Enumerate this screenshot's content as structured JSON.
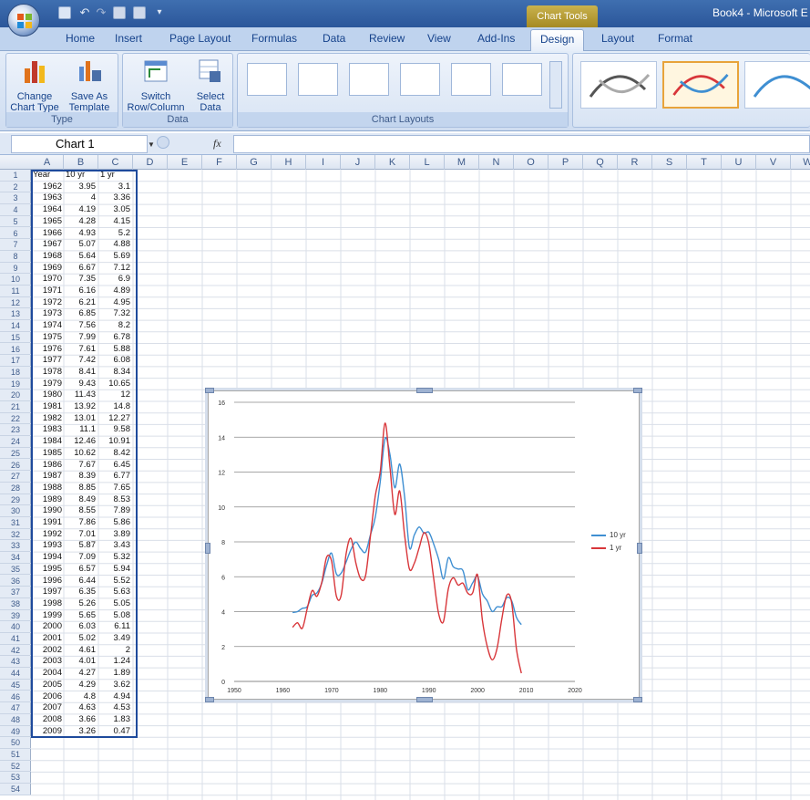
{
  "window": {
    "title": "Book4 - Microsoft E",
    "context_tab": "Chart Tools"
  },
  "tabs": [
    "Home",
    "Insert",
    "Page Layout",
    "Formulas",
    "Data",
    "Review",
    "View",
    "Add-Ins",
    "Design",
    "Layout",
    "Format"
  ],
  "active_tab": "Design",
  "ribbon": {
    "type_group": {
      "label": "Type",
      "buttons": [
        {
          "line1": "Change",
          "line2": "Chart Type"
        },
        {
          "line1": "Save As",
          "line2": "Template"
        }
      ]
    },
    "data_group": {
      "label": "Data",
      "buttons": [
        {
          "line1": "Switch",
          "line2": "Row/Column"
        },
        {
          "line1": "Select",
          "line2": "Data"
        }
      ]
    },
    "layouts_group": {
      "label": "Chart Layouts"
    },
    "colors": {
      "series_10yr": "#3f8fd2",
      "series_1yr": "#d8363a",
      "accent": "#e8a33a"
    }
  },
  "formula_bar": {
    "name_box": "Chart 1",
    "fx": "fx",
    "value": ""
  },
  "columns": [
    "A",
    "B",
    "C",
    "D",
    "E",
    "F",
    "G",
    "H",
    "I",
    "J",
    "K",
    "L",
    "M",
    "N",
    "O",
    "P",
    "Q",
    "R",
    "S",
    "T",
    "U",
    "V",
    "W"
  ],
  "rows_visible": [
    "1",
    "2",
    "3",
    "4",
    "5",
    "6",
    "7",
    "8",
    "9",
    "10",
    "11",
    "12",
    "13",
    "14",
    "15",
    "16",
    "17",
    "18",
    "19",
    "20",
    "21",
    "22",
    "23",
    "24",
    "25",
    "26",
    "27",
    "28",
    "29",
    "30",
    "31",
    "32",
    "33",
    "34",
    "35",
    "36",
    "37",
    "38",
    "39",
    "40",
    "41",
    "42",
    "43",
    "44",
    "45",
    "46",
    "47",
    "48",
    "49",
    "50",
    "51",
    "52",
    "53",
    "54"
  ],
  "table": {
    "headers": [
      "Year",
      "10 yr",
      "1 yr"
    ],
    "rows": [
      [
        "1962",
        "3.95",
        "3.1"
      ],
      [
        "1963",
        "4",
        "3.36"
      ],
      [
        "1964",
        "4.19",
        "3.05"
      ],
      [
        "1965",
        "4.28",
        "4.15"
      ],
      [
        "1966",
        "4.93",
        "5.2"
      ],
      [
        "1967",
        "5.07",
        "4.88"
      ],
      [
        "1968",
        "5.64",
        "5.69"
      ],
      [
        "1969",
        "6.67",
        "7.12"
      ],
      [
        "1970",
        "7.35",
        "6.9"
      ],
      [
        "1971",
        "6.16",
        "4.89"
      ],
      [
        "1972",
        "6.21",
        "4.95"
      ],
      [
        "1973",
        "6.85",
        "7.32"
      ],
      [
        "1974",
        "7.56",
        "8.2"
      ],
      [
        "1975",
        "7.99",
        "6.78"
      ],
      [
        "1976",
        "7.61",
        "5.88"
      ],
      [
        "1977",
        "7.42",
        "6.08"
      ],
      [
        "1978",
        "8.41",
        "8.34"
      ],
      [
        "1979",
        "9.43",
        "10.65"
      ],
      [
        "1980",
        "11.43",
        "12"
      ],
      [
        "1981",
        "13.92",
        "14.8"
      ],
      [
        "1982",
        "13.01",
        "12.27"
      ],
      [
        "1983",
        "11.1",
        "9.58"
      ],
      [
        "1984",
        "12.46",
        "10.91"
      ],
      [
        "1985",
        "10.62",
        "8.42"
      ],
      [
        "1986",
        "7.67",
        "6.45"
      ],
      [
        "1987",
        "8.39",
        "6.77"
      ],
      [
        "1988",
        "8.85",
        "7.65"
      ],
      [
        "1989",
        "8.49",
        "8.53"
      ],
      [
        "1990",
        "8.55",
        "7.89"
      ],
      [
        "1991",
        "7.86",
        "5.86"
      ],
      [
        "1992",
        "7.01",
        "3.89"
      ],
      [
        "1993",
        "5.87",
        "3.43"
      ],
      [
        "1994",
        "7.09",
        "5.32"
      ],
      [
        "1995",
        "6.57",
        "5.94"
      ],
      [
        "1996",
        "6.44",
        "5.52"
      ],
      [
        "1997",
        "6.35",
        "5.63"
      ],
      [
        "1998",
        "5.26",
        "5.05"
      ],
      [
        "1999",
        "5.65",
        "5.08"
      ],
      [
        "2000",
        "6.03",
        "6.11"
      ],
      [
        "2001",
        "5.02",
        "3.49"
      ],
      [
        "2002",
        "4.61",
        "2"
      ],
      [
        "2003",
        "4.01",
        "1.24"
      ],
      [
        "2004",
        "4.27",
        "1.89"
      ],
      [
        "2005",
        "4.29",
        "3.62"
      ],
      [
        "2006",
        "4.8",
        "4.94"
      ],
      [
        "2007",
        "4.63",
        "4.53"
      ],
      [
        "2008",
        "3.66",
        "1.83"
      ],
      [
        "2009",
        "3.26",
        "0.47"
      ]
    ]
  },
  "chart_data": {
    "type": "line",
    "x": [
      1962,
      1963,
      1964,
      1965,
      1966,
      1967,
      1968,
      1969,
      1970,
      1971,
      1972,
      1973,
      1974,
      1975,
      1976,
      1977,
      1978,
      1979,
      1980,
      1981,
      1982,
      1983,
      1984,
      1985,
      1986,
      1987,
      1988,
      1989,
      1990,
      1991,
      1992,
      1993,
      1994,
      1995,
      1996,
      1997,
      1998,
      1999,
      2000,
      2001,
      2002,
      2003,
      2004,
      2005,
      2006,
      2007,
      2008,
      2009
    ],
    "series": [
      {
        "name": "10 yr",
        "color": "#3f8fd2",
        "values": [
          3.95,
          4,
          4.19,
          4.28,
          4.93,
          5.07,
          5.64,
          6.67,
          7.35,
          6.16,
          6.21,
          6.85,
          7.56,
          7.99,
          7.61,
          7.42,
          8.41,
          9.43,
          11.43,
          13.92,
          13.01,
          11.1,
          12.46,
          10.62,
          7.67,
          8.39,
          8.85,
          8.49,
          8.55,
          7.86,
          7.01,
          5.87,
          7.09,
          6.57,
          6.44,
          6.35,
          5.26,
          5.65,
          6.03,
          5.02,
          4.61,
          4.01,
          4.27,
          4.29,
          4.8,
          4.63,
          3.66,
          3.26
        ]
      },
      {
        "name": "1 yr",
        "color": "#d8363a",
        "values": [
          3.1,
          3.36,
          3.05,
          4.15,
          5.2,
          4.88,
          5.69,
          7.12,
          6.9,
          4.89,
          4.95,
          7.32,
          8.2,
          6.78,
          5.88,
          6.08,
          8.34,
          10.65,
          12,
          14.8,
          12.27,
          9.58,
          10.91,
          8.42,
          6.45,
          6.77,
          7.65,
          8.53,
          7.89,
          5.86,
          3.89,
          3.43,
          5.32,
          5.94,
          5.52,
          5.63,
          5.05,
          5.08,
          6.11,
          3.49,
          2,
          1.24,
          1.89,
          3.62,
          4.94,
          4.53,
          1.83,
          0.47
        ]
      }
    ],
    "x_ticks": [
      "1950",
      "1960",
      "1970",
      "1980",
      "1990",
      "2000",
      "2010",
      "2020"
    ],
    "y_ticks": [
      "0",
      "2",
      "4",
      "6",
      "8",
      "10",
      "12",
      "14",
      "16"
    ],
    "xlim": [
      1950,
      2020
    ],
    "ylim": [
      0,
      16
    ],
    "grid": "horizontal",
    "legend": "right",
    "smooth": true
  }
}
